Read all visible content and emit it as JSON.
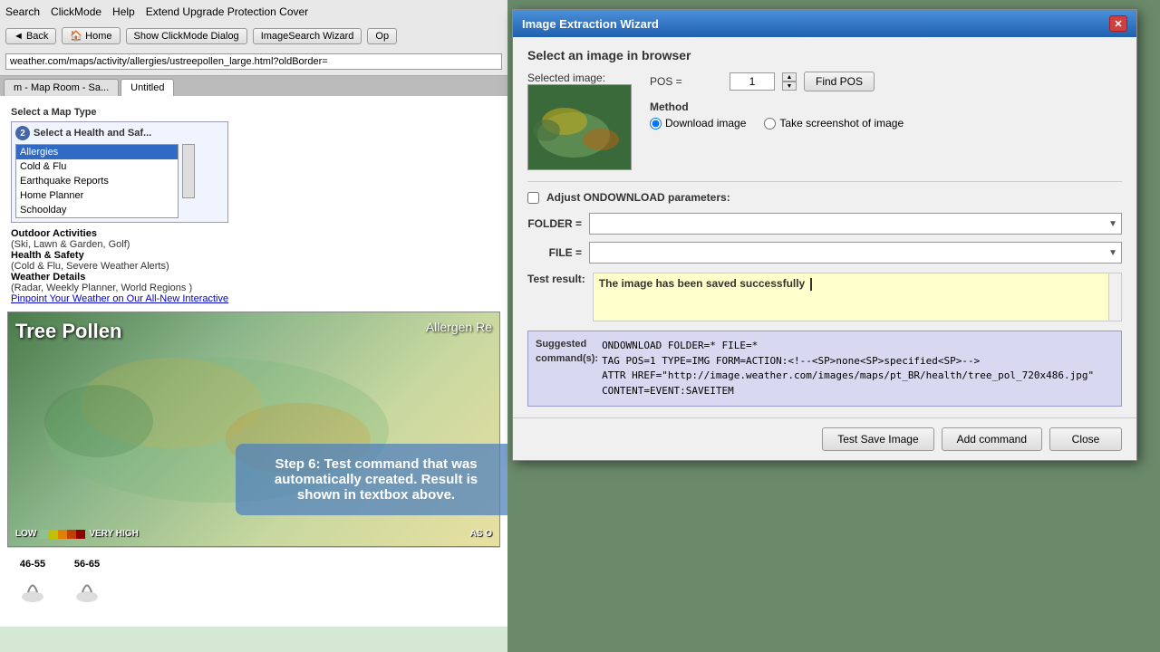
{
  "browser": {
    "menu": [
      "Search",
      "ClickMode",
      "Help",
      "Extend Upgrade Protection Cover"
    ],
    "nav_buttons": [
      "◄ Back",
      "🏠 Home",
      "Show ClickMode Dialog",
      "ImageSearch Wizard",
      "Op"
    ],
    "address": "weather.com/maps/activity/allergies/ustreepollen_large.html?oldBorder=",
    "tabs": [
      {
        "label": "m - Map Room - Sa...",
        "active": false
      },
      {
        "label": "Untitled",
        "active": true
      }
    ]
  },
  "left_panel": {
    "map_type_label": "Select a Map Type",
    "circle_num": "2",
    "health_label": "Select a Health and Saf...",
    "categories": [
      {
        "title": "Outdoor Activities",
        "sub": "(Ski, Lawn & Garden, Golf)"
      },
      {
        "title": "Health & Safety",
        "sub": "(Cold & Flu, Severe Weather Alerts)"
      },
      {
        "title": "Weather Details",
        "sub": "(Radar, Weekly Planner, World Regions )"
      }
    ],
    "listbox_items": [
      {
        "label": "Allergies",
        "selected": true
      },
      {
        "label": "Cold & Flu",
        "selected": false
      },
      {
        "label": "Earthquake Reports",
        "selected": false
      },
      {
        "label": "Home Planner",
        "selected": false
      },
      {
        "label": "Schoolday",
        "selected": false
      }
    ],
    "cat_link": "Pinpoint Your Weather on Our All-New Interactive",
    "pollen_title": "Tree Pollen",
    "allergen_label": "Allergen Re",
    "pollen_scale_low": "LOW",
    "pollen_scale_high": "VERY HIGH",
    "as_of": "AS O"
  },
  "tooltip": {
    "text": "Step 6: Test command that was automatically created. Result is shown in textbox above."
  },
  "dialog": {
    "title": "Image Extraction Wizard",
    "section_title": "Select an image in browser",
    "selected_image_label": "Selected image:",
    "pos_label": "POS =",
    "pos_value": "1",
    "find_pos_button": "Find POS",
    "method_label": "Method",
    "method_options": [
      {
        "label": "Download image",
        "selected": true
      },
      {
        "label": "Take screenshot of image",
        "selected": false
      }
    ],
    "adjust_label": "Adjust ONDOWNLOAD parameters:",
    "folder_label": "FOLDER =",
    "folder_value": "",
    "file_label": "FILE =",
    "file_value": "",
    "test_result_label": "Test result:",
    "test_result_text": "The image has been saved successfully",
    "suggested_label": "Suggested",
    "command_label": "command(s):",
    "suggested_command_line1": "ONDOWNLOAD FOLDER=* FILE=*",
    "suggested_command_line2": "TAG POS=1 TYPE=IMG FORM=ACTION:<!--<SP>none<SP>specified<SP>-->",
    "suggested_command_line3": "ATTR HREF=\"http://image.weather.com/images/maps/pt_BR/health/tree_pol_720x486.jpg\"",
    "suggested_command_line4": "CONTENT=EVENT:SAVEITEM",
    "buttons": {
      "test_save": "Test Save Image",
      "add_command": "Add command",
      "close": "Close"
    }
  }
}
